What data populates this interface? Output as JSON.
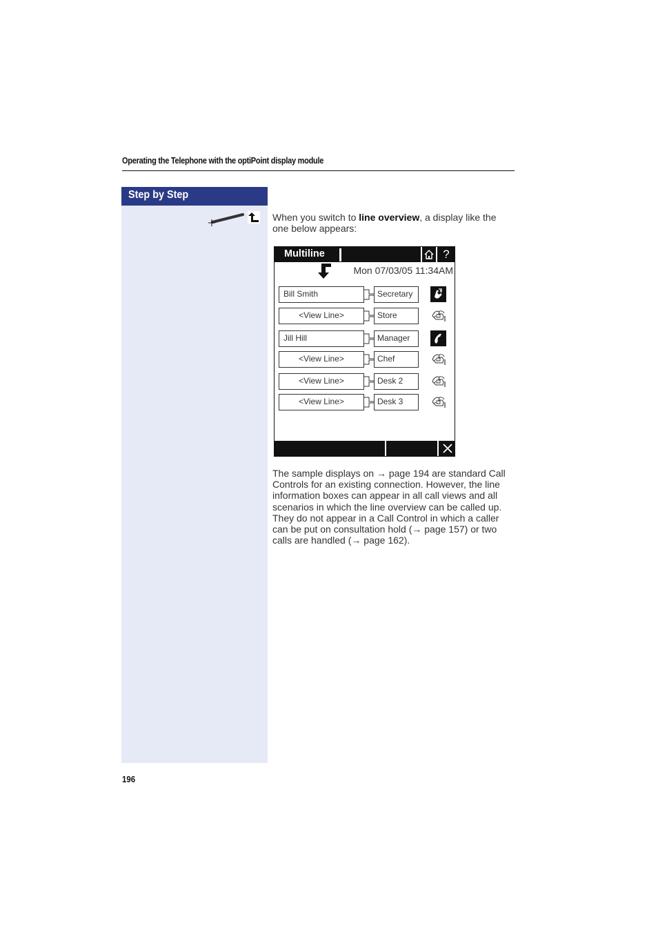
{
  "header": {
    "title": "Operating the Telephone with the optiPoint display module"
  },
  "sidebar": {
    "title": "Step by Step",
    "icons": [
      "pen-icon",
      "back-arrow-icon"
    ]
  },
  "intro": {
    "prefix": "When you switch to ",
    "bold": "line overview",
    "suffix": ", a display like the one below appears:"
  },
  "display": {
    "title": "Multiline",
    "help_label": "?",
    "datetime": "Mon 07/03/05 11:34AM",
    "lines": [
      {
        "name": "Bill Smith",
        "align": "left",
        "tag": "Secretary",
        "status": "active-call-icon"
      },
      {
        "name": "<View Line>",
        "align": "center",
        "tag": "Store",
        "status": "idle-phone-icon"
      },
      {
        "name": "Jill Hill",
        "align": "left",
        "tag": "Manager",
        "status": "handset-icon"
      },
      {
        "name": "<View Line>",
        "align": "center",
        "tag": "Chef",
        "status": "idle-phone-icon"
      },
      {
        "name": "<View Line>",
        "align": "center",
        "tag": "Desk 2",
        "status": "idle-phone-icon"
      },
      {
        "name": "<View Line>",
        "align": "center",
        "tag": "Desk 3",
        "status": "idle-phone-icon"
      }
    ]
  },
  "body": {
    "text": "The sample displays on → page 194 are standard Call Controls for an existing connection. However, the line information boxes can appear in all call views and all scenarios in which the line overview can be called up. They do not appear in a Call Control in which a caller can be put on consultation hold (→ page 157) or two calls are handled (→ page 162)."
  },
  "page_number": "196",
  "colors": {
    "sidebar_header": "#2b3a87",
    "sidebar_bg": "#e6eaf6"
  }
}
